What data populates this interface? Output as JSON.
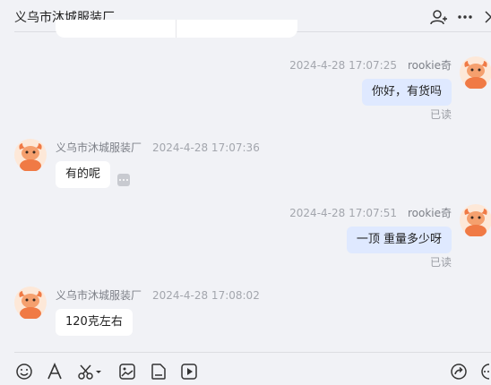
{
  "header": {
    "title": "义乌市沐城服装厂",
    "icons": [
      "add-person-icon",
      "more-icon",
      "close-icon"
    ]
  },
  "messages": [
    {
      "direction": "out",
      "sender": "rookie奇",
      "time": "2024-4-28 17:07:25",
      "text": "你好，有货吗",
      "status": "已读"
    },
    {
      "direction": "in",
      "sender": "义乌市沐城服装厂",
      "time": "2024-4-28 17:07:36",
      "text": "有的呢"
    },
    {
      "direction": "out",
      "sender": "rookie奇",
      "time": "2024-4-28 17:07:51",
      "text": "一顶 重量多少呀",
      "status": "已读"
    },
    {
      "direction": "in",
      "sender": "义乌市沐城服装厂",
      "time": "2024-4-28 17:08:02",
      "text": "120克左右"
    }
  ],
  "toolbar": {
    "left_icons": [
      "emoji-icon",
      "font-icon",
      "scissors-icon",
      "image-icon",
      "file-icon",
      "video-icon"
    ],
    "right_icons": [
      "share-icon",
      "quick-reply-icon"
    ]
  },
  "colors": {
    "background": "#f1f2f6",
    "incoming_bubble": "#ffffff",
    "outgoing_bubble": "#dfe9ff",
    "avatar_bg": "#fde8d8",
    "avatar_accent": "#f07a45"
  }
}
